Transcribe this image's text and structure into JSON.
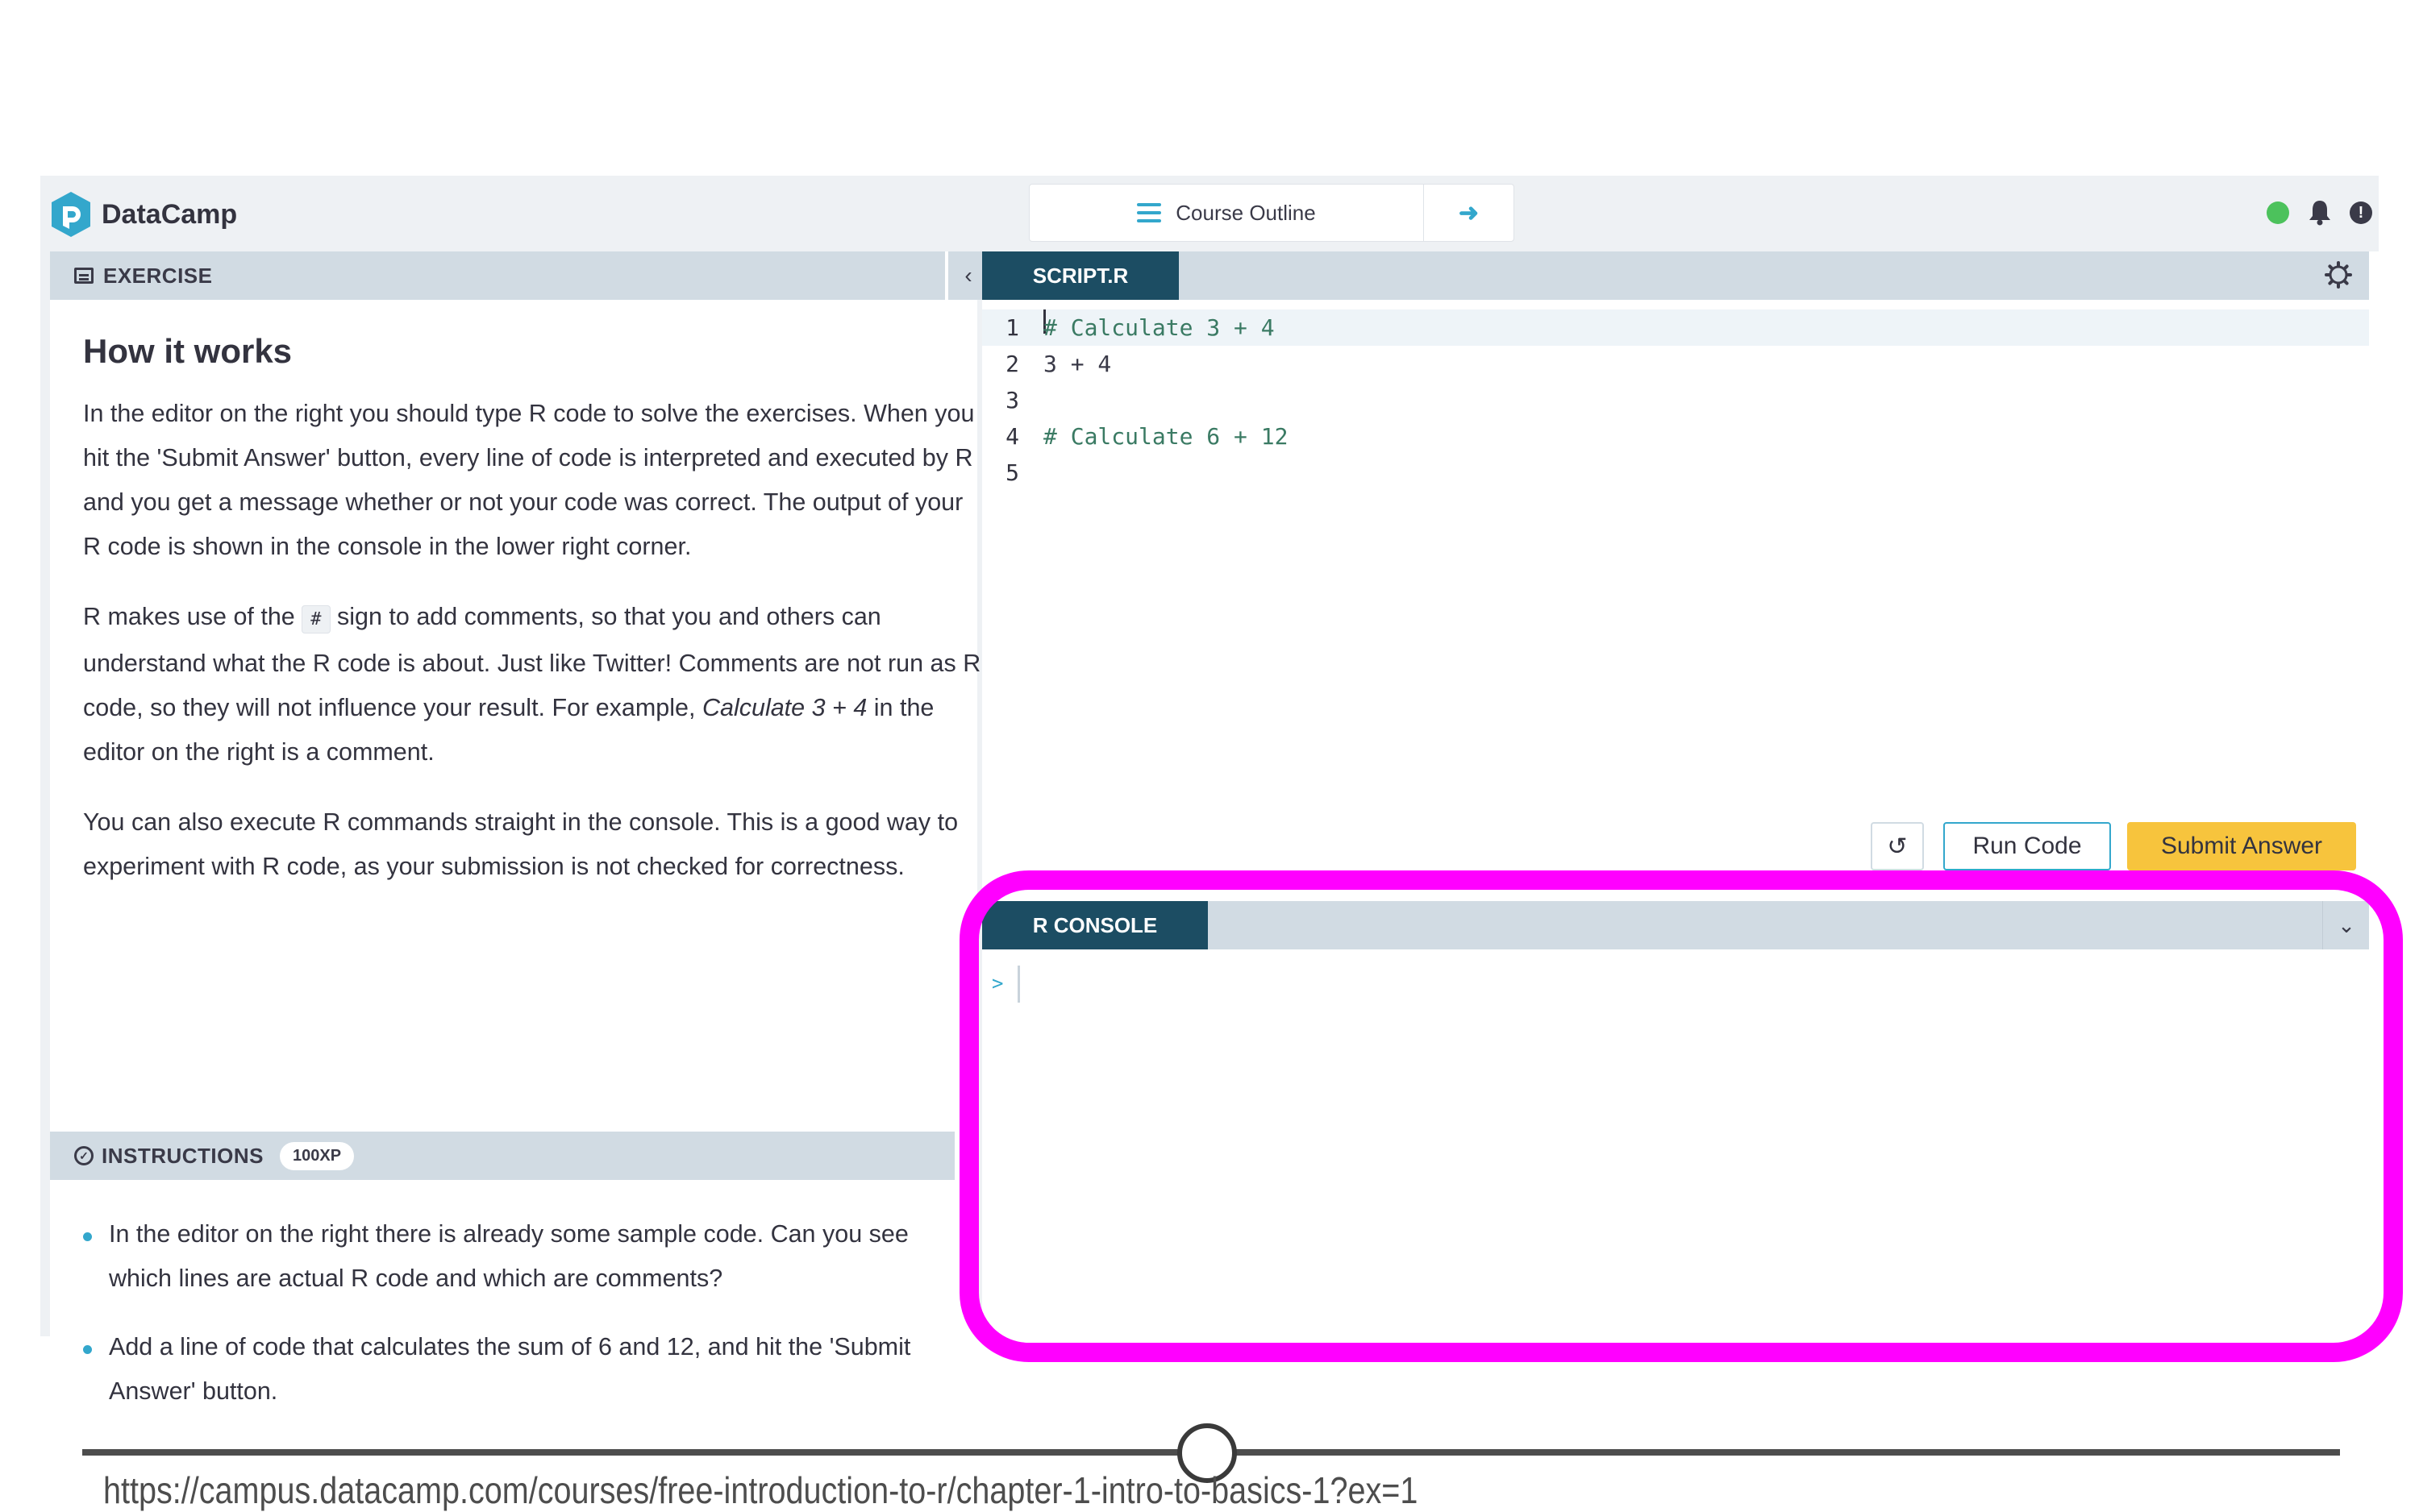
{
  "brand": {
    "name": "DataCamp"
  },
  "topbar": {
    "course_outline_label": "Course Outline",
    "icons": [
      "hamburger-icon",
      "arrow-right-icon",
      "status-dot-icon",
      "bell-icon",
      "info-icon"
    ],
    "status_color": "#4cc25c"
  },
  "exercise": {
    "header": "EXERCISE",
    "title": "How it works",
    "p1": "In the editor on the right you should type R code to solve the exercises. When you hit the 'Submit Answer' button, every line of code is interpreted and executed by R and you get a message whether or not your code was correct. The output of your R code is shown in the console in the lower right corner.",
    "p2_pre": "R makes use of the",
    "p2_code": "#",
    "p2_post": "sign to add comments, so that you and others can understand what the R code is about. Just like Twitter! Comments are not run as R code, so they will not influence your result. For example,",
    "p2_em": "Calculate 3 + 4",
    "p2_end": "in the editor on the right is a comment.",
    "p3": "You can also execute R commands straight in the console. This is a good way to experiment with R code, as your submission is not checked for correctness."
  },
  "instructions": {
    "header": "INSTRUCTIONS",
    "xp": "100XP",
    "items": [
      "In the editor on the right there is already some sample code. Can you see which lines are actual R code and which are comments?",
      "Add a line of code that calculates the sum of 6 and 12, and hit the 'Submit Answer' button."
    ]
  },
  "editor": {
    "tab": "SCRIPT.R",
    "lines": [
      {
        "num": "1",
        "text": "# Calculate 3 + 4"
      },
      {
        "num": "2",
        "text": "3 + 4"
      },
      {
        "num": "3",
        "text": ""
      },
      {
        "num": "4",
        "text": "# Calculate 6 + 12"
      },
      {
        "num": "5",
        "text": ""
      }
    ],
    "run_label": "Run Code",
    "submit_label": "Submit Answer",
    "accent": "#1c4d63",
    "submit_color": "#f7c43d"
  },
  "console": {
    "tab": "R CONSOLE",
    "prompt": ">"
  },
  "player": {
    "url": "https://campus.datacamp.com/courses/free-introduction-to-r/chapter-1-intro-to-basics-1?ex=1",
    "highlight_color": "#ff00ff"
  }
}
